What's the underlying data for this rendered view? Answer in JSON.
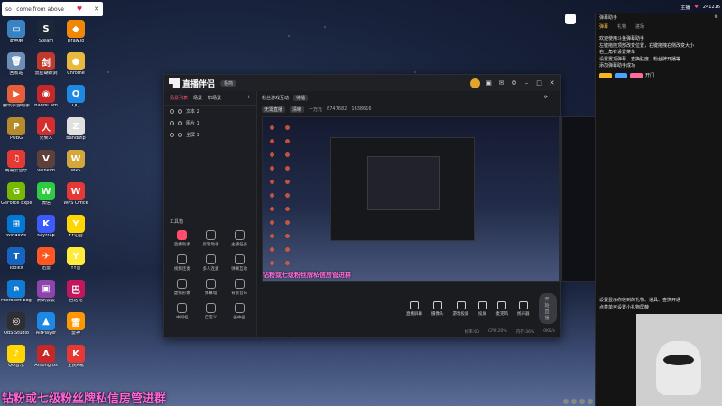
{
  "notification": {
    "text": "so i come from above",
    "heart": "♥",
    "menu": "⋮",
    "close": "✕"
  },
  "desktop_icons": [
    {
      "label": "此电脑",
      "color": "#3b82c4",
      "glyph": "▭"
    },
    {
      "label": "Steam",
      "color": "#1b2838",
      "glyph": "S"
    },
    {
      "label": "Draw.io",
      "color": "#f08705",
      "glyph": "◆"
    },
    {
      "label": "回收站",
      "color": "#6e8fb5",
      "glyph": "🗑"
    },
    {
      "label": "流星蝴蝶剑",
      "color": "#c0392b",
      "glyph": "剑"
    },
    {
      "label": "Chrome",
      "color": "#e8b93d",
      "glyph": "●"
    },
    {
      "label": "腾讯手游助手",
      "color": "#e85d3a",
      "glyph": "▶"
    },
    {
      "label": "BandiCam",
      "color": "#c62828",
      "glyph": "◉"
    },
    {
      "label": "QQ",
      "color": "#1e88e5",
      "glyph": "Q"
    },
    {
      "label": "PUBG",
      "color": "#b58b2b",
      "glyph": "P"
    },
    {
      "label": "火柴人",
      "color": "#d32f2f",
      "glyph": "人"
    },
    {
      "label": "Bandizip",
      "color": "#e0e0e0",
      "glyph": "Z"
    },
    {
      "label": "网易云音乐",
      "color": "#e53935",
      "glyph": "♫"
    },
    {
      "label": "Valheim",
      "color": "#5d4037",
      "glyph": "V"
    },
    {
      "label": "WPS",
      "color": "#d4a73a",
      "glyph": "W"
    },
    {
      "label": "GeForce Experience",
      "color": "#76b900",
      "glyph": "G"
    },
    {
      "label": "微信",
      "color": "#2ecc40",
      "glyph": "W"
    },
    {
      "label": "WPS Office",
      "color": "#e53935",
      "glyph": "W"
    },
    {
      "label": "Windows",
      "color": "#0078d4",
      "glyph": "⊞"
    },
    {
      "label": "KeyMap",
      "color": "#3d5afe",
      "glyph": "K"
    },
    {
      "label": "YY语音",
      "color": "#ffd600",
      "glyph": "Y"
    },
    {
      "label": "Toolkit",
      "color": "#1565c0",
      "glyph": "T"
    },
    {
      "label": "迅雷",
      "color": "#ff5722",
      "glyph": "✈"
    },
    {
      "label": "YY音",
      "color": "#ffeb3b",
      "glyph": "Y"
    },
    {
      "label": "Microsoft Edge",
      "color": "#0f7bd4",
      "glyph": "e"
    },
    {
      "label": "腾讯会议",
      "color": "#8e44ad",
      "glyph": "▣"
    },
    {
      "label": "巴洛克",
      "color": "#c2185b",
      "glyph": "巴"
    },
    {
      "label": "OBS Studio",
      "color": "#302e31",
      "glyph": "◎"
    },
    {
      "label": "AirPlayer",
      "color": "#1e88e5",
      "glyph": "▲"
    },
    {
      "label": "雷神",
      "color": "#ff9800",
      "glyph": "雷"
    },
    {
      "label": "QQ音乐",
      "color": "#ffd600",
      "glyph": "♪"
    },
    {
      "label": "Among Us",
      "color": "#c62828",
      "glyph": "A"
    },
    {
      "label": "全民K歌",
      "color": "#e53935",
      "glyph": "K"
    }
  ],
  "app": {
    "brand": "直播伴侣",
    "version_badge": "极简",
    "scene_tabs": [
      "场景列表",
      "场景",
      "布场景"
    ],
    "sources": [
      "文本 2",
      "图片 1",
      "全屏 1"
    ],
    "tools_title": "工具箱",
    "tools": [
      "直播助手",
      "房管助手",
      "主播任务",
      "视频连麦",
      "多人连麦",
      "弹幕互动",
      "虚拟形象",
      "弹幕墙",
      "背景音乐",
      "中间栏",
      "自定义",
      "画中画"
    ],
    "stream_title": "粉丝游戏互动",
    "stream_tag": "待播",
    "stream_sub": [
      "无需直播",
      "清晰",
      "一万元"
    ],
    "stream_stats": [
      "8747682",
      "1638616"
    ],
    "preview_banner": "钻粉或七级粉丝牌私信房管进群",
    "controls": [
      "直播屏幕",
      "摄像头",
      "游戏投屏",
      "投屏",
      "麦克风",
      "扬声器"
    ],
    "start_label": "开始直播",
    "status": [
      "帧率:60",
      "CPU:20%",
      "内存:36%",
      "0KB/s"
    ]
  },
  "right_panel": {
    "header": "弹幕助手",
    "tabs": [
      "弹幕",
      "礼物",
      "进场"
    ],
    "messages": [
      "欢迎使用斗鱼弹幕助手",
      "左键拖拽顶部改变位置，右键拖拽右侧改变大小",
      "右上角有设置菜单",
      "设置置顶弹幕、查换肤度、粉丝牌开播等",
      "添加弹幕助手成功"
    ],
    "user_line": "开门",
    "gift_tip": [
      "设置显示你收到的礼物、道具、查换开通",
      "点菜单可设置小礼物屏蔽"
    ]
  },
  "counters": {
    "user": "主播",
    "count": "241216"
  },
  "overlay_banner": "钻粉或七级粉丝牌私信房管进群"
}
